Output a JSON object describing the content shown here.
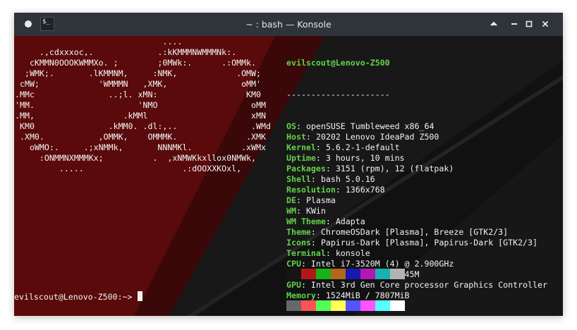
{
  "window": {
    "title": "~ : bash — Konsole",
    "app_icon_text": "$_"
  },
  "titlebar_buttons": {
    "keep_above": "^",
    "minimize": "–",
    "maximize": "□",
    "close": "×"
  },
  "terminal": {
    "ascii_art": [
      "                              ....",
      "     .,cdxxxoc,.             .:kKMMMNWMMMNk:.",
      "   cKMMN0OOOKWMMXo. ;        ;0MWk:.      .:OMMk.",
      "  ;WMK;.       .lKMMNM,     :NMK,            .OMW;",
      " cMW;            'WMMMN   ,XMK,               oMM'",
      ".MMc               ..;l. xMN:                  KM0",
      "'MM.                     'NMO                   oMM",
      ".MM,                  .kMMl                     xMN",
      " KM0               .kMM0. .dl:,..               .WMd",
      " .XM0.           ,OMMK,    OMMMK.              .XMK",
      "   oWMO:.     .;xNMMk,       NNNMKl.          .xWMx",
      "     :ONMMNXMMMKx;          .  ,xNMWKkxllox0NMWk,",
      "         .....                    .:dOOXXKOxl,"
    ],
    "info": {
      "user_host": "evilscout@Lenovo-Z500",
      "separator": "---------------------",
      "fields": [
        {
          "key": "OS",
          "value": "openSUSE Tumbleweed x86_64"
        },
        {
          "key": "Host",
          "value": "20202 Lenovo IdeaPad Z500"
        },
        {
          "key": "Kernel",
          "value": "5.6.2-1-default"
        },
        {
          "key": "Uptime",
          "value": "3 hours, 10 mins"
        },
        {
          "key": "Packages",
          "value": "3151 (rpm), 12 (flatpak)"
        },
        {
          "key": "Shell",
          "value": "bash 5.0.16"
        },
        {
          "key": "Resolution",
          "value": "1366x768"
        },
        {
          "key": "DE",
          "value": "Plasma"
        },
        {
          "key": "WM",
          "value": "KWin"
        },
        {
          "key": "WM Theme",
          "value": "Adapta"
        },
        {
          "key": "Theme",
          "value": "ChromeOSDark [Plasma], Breeze [GTK2/3]"
        },
        {
          "key": "Icons",
          "value": "Papirus-Dark [Plasma], Papirus-Dark [GTK2/3]"
        },
        {
          "key": "Terminal",
          "value": "konsole"
        },
        {
          "key": "CPU",
          "value": "Intel i7-3520M (4) @ 2.900GHz"
        },
        {
          "key": "GPU",
          "value": "NVIDIA GeForce GT 645M"
        },
        {
          "key": "GPU",
          "value": "Intel 3rd Gen Core processor Graphics Controller"
        },
        {
          "key": "Memory",
          "value": "1524MiB / 7807MiB"
        }
      ]
    },
    "palette": {
      "row1": [
        "#151515",
        "#b21818",
        "#18b218",
        "#b26818",
        "#1818b2",
        "#b218b2",
        "#18b2b2",
        "#b2b2b2"
      ],
      "row2": [
        "#686868",
        "#ff5454",
        "#54ff54",
        "#ffff54",
        "#5454ff",
        "#ff54ff",
        "#54ffff",
        "#ffffff"
      ]
    },
    "prompt": "evilscout@Lenovo-Z500:~> "
  },
  "colors": {
    "accent_green": "#62d34a",
    "background_red": "#5a0a0a",
    "titlebar": "#2f343b"
  }
}
